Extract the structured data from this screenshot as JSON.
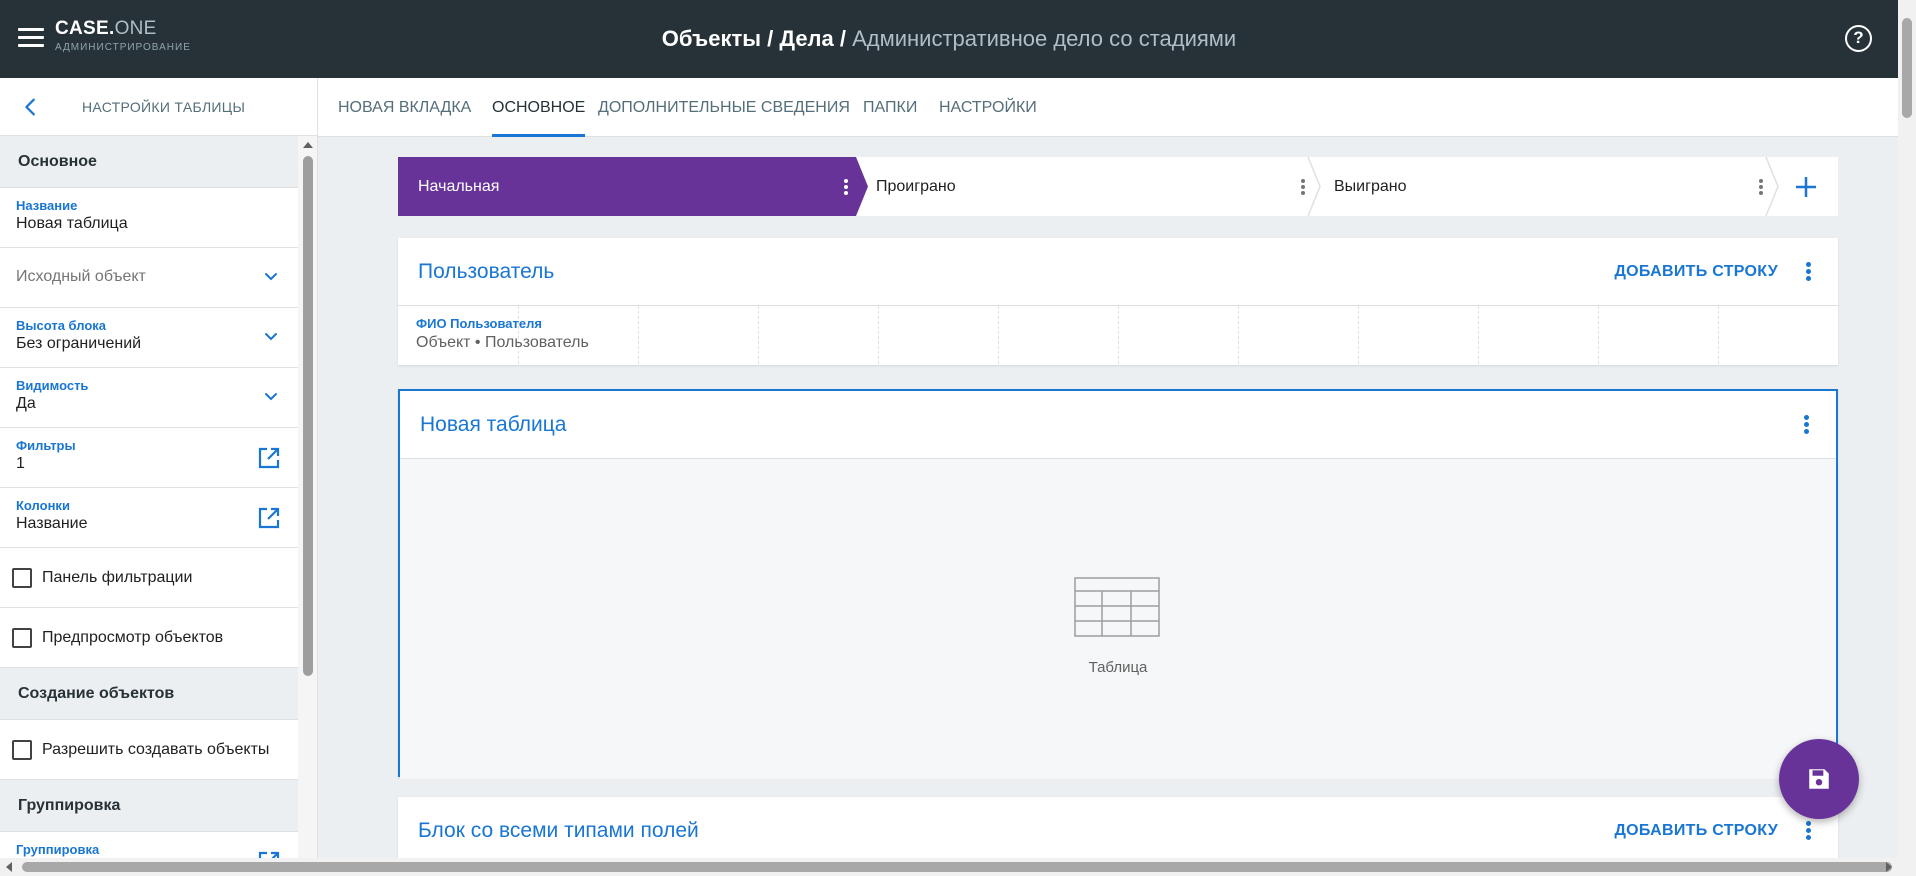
{
  "header": {
    "logo_main": "CASE.",
    "logo_one": "ONE",
    "logo_sub": "АДМИНИСТРИРОВАНИЕ",
    "breadcrumb_1": "Объекты",
    "breadcrumb_sep": " / ",
    "breadcrumb_2": "Дела",
    "breadcrumb_current": "Административное дело со стадиями",
    "help_icon": "?"
  },
  "sidebar": {
    "title": "НАСТРОЙКИ ТАБЛИЦЫ",
    "section_main": "Основное",
    "name_label": "Название",
    "name_value": "Новая таблица",
    "source_placeholder": "Исходный объект",
    "height_label": "Высота блока",
    "height_value": "Без ограничений",
    "visibility_label": "Видимость",
    "visibility_value": "Да",
    "filters_label": "Фильтры",
    "filters_value": "1",
    "columns_label": "Колонки",
    "columns_value": "Название",
    "filter_panel": "Панель фильтрации",
    "preview_objects": "Предпросмотр объектов",
    "section_create": "Создание объектов",
    "allow_create": "Разрешить создавать объекты",
    "section_group": "Группировка",
    "group_label": "Группировка"
  },
  "tabs": [
    {
      "label": "НОВАЯ ВКЛАДКА"
    },
    {
      "label": "ОСНОВНОЕ"
    },
    {
      "label": "ДОПОЛНИТЕЛЬНЫЕ СВЕДЕНИЯ"
    },
    {
      "label": "ПАПКИ"
    },
    {
      "label": "НАСТРОЙКИ"
    }
  ],
  "stages": [
    {
      "label": "Начальная"
    },
    {
      "label": "Проиграно"
    },
    {
      "label": "Выиграно"
    }
  ],
  "blocks": {
    "user_title": "Пользователь",
    "user_action": "ДОБАВИТЬ СТРОКУ",
    "user_field_label": "ФИО Пользователя",
    "user_field_value": "Объект • Пользователь",
    "table_title": "Новая таблица",
    "table_empty_label": "Таблица",
    "all_fields_title": "Блок со всеми типами полей",
    "all_fields_action": "ДОБАВИТЬ СТРОКУ"
  },
  "colors": {
    "accent": "#1976d2",
    "purple": "#673399",
    "header_bg": "#263238"
  }
}
